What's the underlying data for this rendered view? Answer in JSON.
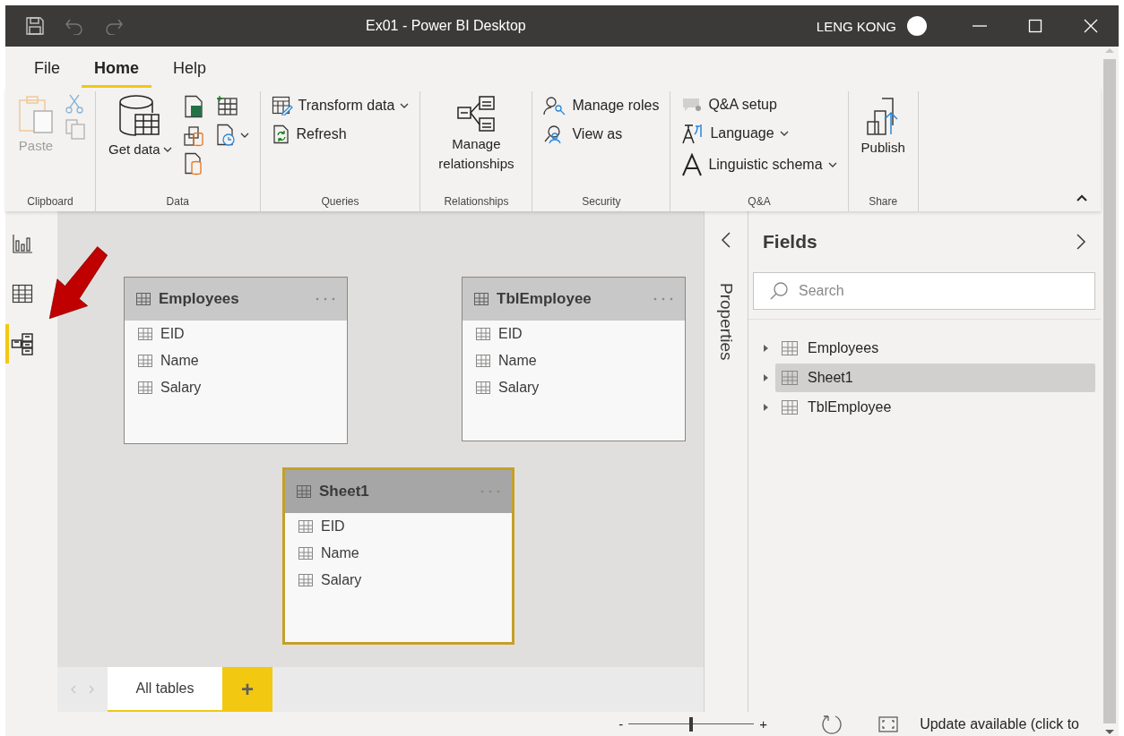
{
  "window": {
    "title": "Ex01 - Power BI Desktop",
    "user": "LENG KONG"
  },
  "ribbon": {
    "tabs": [
      {
        "label": "File",
        "selected": false
      },
      {
        "label": "Home",
        "selected": true
      },
      {
        "label": "Help",
        "selected": false
      }
    ],
    "groups": [
      {
        "label": "Clipboard",
        "kind": "clipboard",
        "items": [
          {
            "label": "Paste",
            "dropdown": false,
            "disabled": true
          }
        ]
      },
      {
        "label": "Data",
        "kind": "data",
        "items": [
          {
            "label": "Get data",
            "dropdown": true,
            "disabled": false
          }
        ]
      },
      {
        "label": "Queries",
        "kind": "list",
        "items": [
          {
            "label": "Transform data",
            "dropdown": true,
            "disabled": false
          },
          {
            "label": "Refresh",
            "dropdown": false,
            "disabled": false
          }
        ]
      },
      {
        "label": "Relationships",
        "kind": "large",
        "items": [
          {
            "label": "Manage relationships",
            "dropdown": false,
            "disabled": false
          }
        ]
      },
      {
        "label": "Security",
        "kind": "list",
        "items": [
          {
            "label": "Manage roles",
            "dropdown": false,
            "disabled": false
          },
          {
            "label": "View as",
            "dropdown": false,
            "disabled": false
          }
        ]
      },
      {
        "label": "Q&A",
        "kind": "list",
        "items": [
          {
            "label": "Q&A setup",
            "dropdown": false,
            "disabled": false
          },
          {
            "label": "Language",
            "dropdown": true,
            "disabled": false
          },
          {
            "label": "Linguistic schema",
            "dropdown": true,
            "disabled": false
          }
        ]
      },
      {
        "label": "Share",
        "kind": "large",
        "items": [
          {
            "label": "Publish",
            "dropdown": false,
            "disabled": false
          }
        ]
      }
    ]
  },
  "views": [
    {
      "selected": false
    },
    {
      "selected": false
    },
    {
      "selected": true
    }
  ],
  "tables": [
    {
      "name": "Employees",
      "selected": false,
      "fields": [
        "EID",
        "Name",
        "Salary"
      ]
    },
    {
      "name": "TblEmployee",
      "selected": false,
      "fields": [
        "EID",
        "Name",
        "Salary"
      ]
    },
    {
      "name": "Sheet1",
      "selected": true,
      "fields": [
        "EID",
        "Name",
        "Salary"
      ]
    }
  ],
  "layout_tabs": [
    {
      "label": "All tables",
      "selected": true
    }
  ],
  "add_tab": "+",
  "properties": {
    "label": "Properties"
  },
  "fields_pane": {
    "title": "Fields",
    "search": {
      "placeholder": "Search"
    },
    "tables": [
      {
        "name": "Employees",
        "expanded": false,
        "selected": false
      },
      {
        "name": "Sheet1",
        "expanded": false,
        "selected": true
      },
      {
        "name": "TblEmployee",
        "expanded": false,
        "selected": false
      }
    ]
  },
  "status_bar": {
    "zoom_out": "-",
    "zoom": {
      "level": 0.5
    },
    "zoom_in": "+",
    "message": "Update available (click to"
  }
}
